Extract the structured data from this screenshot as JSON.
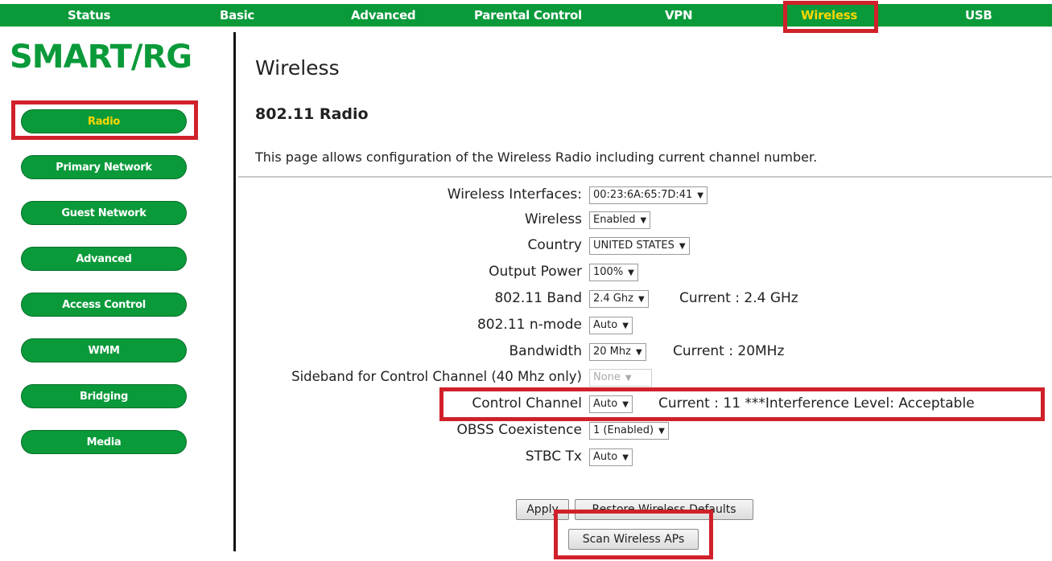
{
  "topnav": {
    "items": [
      {
        "label": "Status"
      },
      {
        "label": "Basic"
      },
      {
        "label": "Advanced"
      },
      {
        "label": "Parental Control"
      },
      {
        "label": "VPN"
      },
      {
        "label": "Wireless",
        "active": true
      },
      {
        "label": "USB"
      }
    ]
  },
  "logo": {
    "text": "SMART/RG"
  },
  "sidebar": {
    "items": [
      {
        "label": "Radio",
        "active": true
      },
      {
        "label": "Primary Network"
      },
      {
        "label": "Guest Network"
      },
      {
        "label": "Advanced"
      },
      {
        "label": "Access Control"
      },
      {
        "label": "WMM"
      },
      {
        "label": "Bridging"
      },
      {
        "label": "Media"
      }
    ]
  },
  "main": {
    "title": "Wireless",
    "section_title": "802.11 Radio",
    "description": "This page allows configuration of the Wireless Radio including current channel number.",
    "fields": {
      "interfaces": {
        "label": "Wireless Interfaces:",
        "value": "00:23:6A:65:7D:41"
      },
      "wireless": {
        "label": "Wireless",
        "value": "Enabled"
      },
      "country": {
        "label": "Country",
        "value": "UNITED STATES"
      },
      "output_power": {
        "label": "Output Power",
        "value": "100%"
      },
      "band": {
        "label": "802.11 Band",
        "value": "2.4 Ghz",
        "current": "Current :  2.4 GHz"
      },
      "n_mode": {
        "label": "802.11 n-mode",
        "value": "Auto"
      },
      "bandwidth": {
        "label": "Bandwidth",
        "value": "20 Mhz",
        "current": "Current :  20MHz"
      },
      "sideband": {
        "label": "Sideband for Control Channel (40 Mhz only)",
        "value": "None"
      },
      "control_channel": {
        "label": "Control Channel",
        "value": "Auto",
        "current": "Current :  11 ***Interference Level: Acceptable"
      },
      "obss": {
        "label": "OBSS Coexistence",
        "value": "1 (Enabled)"
      },
      "stbc": {
        "label": "STBC Tx",
        "value": "Auto"
      }
    },
    "buttons": {
      "apply": "Apply",
      "restore": "Restore Wireless Defaults",
      "scan": "Scan Wireless APs"
    }
  },
  "colors": {
    "brand_green": "#0a9a3a",
    "active_yellow": "#ffd700",
    "highlight_red": "#d0212a"
  }
}
